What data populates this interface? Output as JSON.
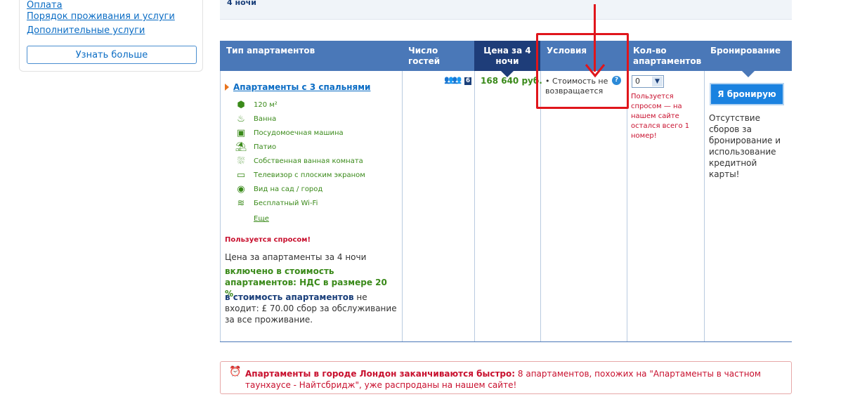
{
  "sidebar": {
    "links": [
      "Оплата",
      "Порядок проживания и услуги",
      "Дополнительные услуги"
    ],
    "learn_more": "Узнать больше"
  },
  "summary": {
    "nights": "4 ночи"
  },
  "table": {
    "headers": {
      "type": "Тип апартаментов",
      "guests": "Число гостей",
      "price": "Цена за 4 ночи",
      "conditions": "Условия",
      "quantity": "Кол-во апартаментов",
      "booking": "Бронирование"
    },
    "row": {
      "title": "Апартаменты с 3 спальнями",
      "features": [
        {
          "icon": "area-icon",
          "label": "120 м²"
        },
        {
          "icon": "bath-icon",
          "label": "Ванна"
        },
        {
          "icon": "dishwasher-icon",
          "label": "Посудомоечная машина"
        },
        {
          "icon": "patio-icon",
          "label": "Патио"
        },
        {
          "icon": "shower-icon",
          "label": "Собственная ванная комната"
        },
        {
          "icon": "tv-icon",
          "label": "Телевизор с плоским экраном"
        },
        {
          "icon": "eye-icon",
          "label": "Вид на сад / город"
        },
        {
          "icon": "wifi-icon",
          "label": "Бесплатный Wi-Fi"
        }
      ],
      "more": "Еще",
      "popular": "Пользуется спросом!",
      "price_note": "Цена за апартаменты за 4 ночи",
      "included": "включено в стоимость апартаментов: НДС в размере 20 %",
      "excluded_bold": "в стоимость апартаментов",
      "excluded_rest": " не входит: £ 70.00 сбор за обслуживание за все проживание.",
      "guests_count": "6",
      "price": "168 640 руб.",
      "condition": "Стоимость не возвращается",
      "qty_value": "0",
      "qty_note": "Пользуется спросом — на нашем сайте остался всего 1 номер!",
      "book_button": "Я бронирую",
      "book_note": "Отсутствие сборов за бронирование и использование кредитной карты!"
    }
  },
  "alert": {
    "bold": "Апартаменты в городе Лондон заканчиваются быстро:",
    "text": " 8 апартаментов, похожих на \"Апартаменты в частном таунхаусе - Найтсбридж\", уже распроданы на нашем сайте!"
  },
  "colors": {
    "header": "#4a78b8",
    "price_header": "#1e3d79",
    "annotation": "#e0151b",
    "green": "#3a8a1a"
  }
}
